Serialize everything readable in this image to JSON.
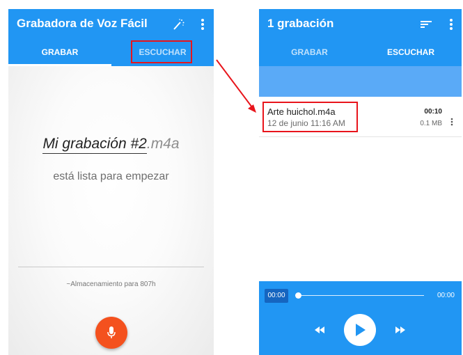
{
  "left_screen": {
    "app_title": "Grabadora de Voz Fácil",
    "tabs": [
      {
        "label": "GRABAR",
        "active": true
      },
      {
        "label": "ESCUCHAR",
        "active": false
      }
    ],
    "file_name": "Mi grabación #2",
    "file_extension": ".m4a",
    "ready_text": "está lista para empezar",
    "storage_text": "~Almacenamiento para 807h",
    "icons": {
      "magic": "magic-wand-icon",
      "menu": "more-vert-icon",
      "record": "microphone-icon"
    }
  },
  "right_screen": {
    "app_title": "1 grabación",
    "tabs": [
      {
        "label": "GRABAR",
        "active": false
      },
      {
        "label": "ESCUCHAR",
        "active": true
      }
    ],
    "recordings": [
      {
        "name": "Arte huichol.m4a",
        "date": "12 de junio 11:16 AM",
        "duration": "00:10",
        "size": "0.1 MB"
      }
    ],
    "player": {
      "current_time": "00:00",
      "total_time": "00:00",
      "progress": 0
    },
    "icons": {
      "sort": "sort-icon",
      "menu": "more-vert-icon",
      "play": "play-icon",
      "rewind": "rewind-icon",
      "forward": "fast-forward-icon"
    }
  },
  "colors": {
    "primary": "#2196f3",
    "record_button": "#f4511e",
    "highlight": "#e8141b"
  }
}
